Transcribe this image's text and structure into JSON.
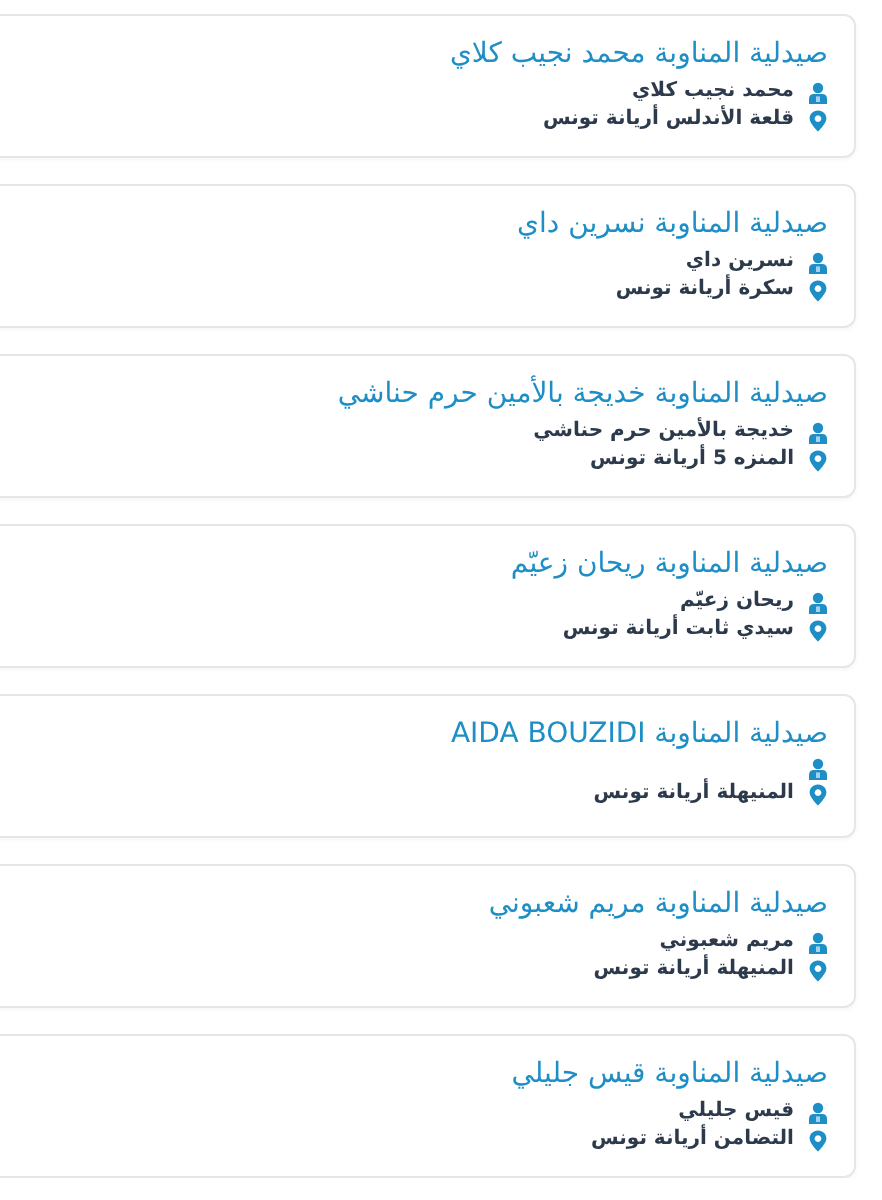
{
  "pharmacies": [
    {
      "title": "صيدلية المناوبة محمد نجيب كلاي",
      "owner": "محمد نجيب كلاي",
      "location": "قلعة الأندلس أريانة تونس"
    },
    {
      "title": "صيدلية المناوبة نسرين داي",
      "owner": "نسرين داي",
      "location": "سكرة أريانة تونس"
    },
    {
      "title": "صيدلية المناوبة خديجة بالأمين حرم حناشي",
      "owner": "خديجة بالأمين حرم حناشي",
      "location": "المنزه 5 أريانة تونس"
    },
    {
      "title": "صيدلية المناوبة ريحان زعيّم",
      "owner": "ريحان زعيّم",
      "location": "سيدي ثابت أريانة تونس"
    },
    {
      "title": "صيدلية المناوبة AIDA BOUZIDI",
      "location": "المنيهلة أريانة تونس"
    },
    {
      "title": "صيدلية المناوبة مريم شعبوني",
      "owner": "مريم شعبوني",
      "location": "المنيهلة أريانة تونس"
    },
    {
      "title": "صيدلية المناوبة قيس جليلي",
      "owner": "قيس جليلي",
      "location": "التضامن أريانة تونس"
    }
  ]
}
